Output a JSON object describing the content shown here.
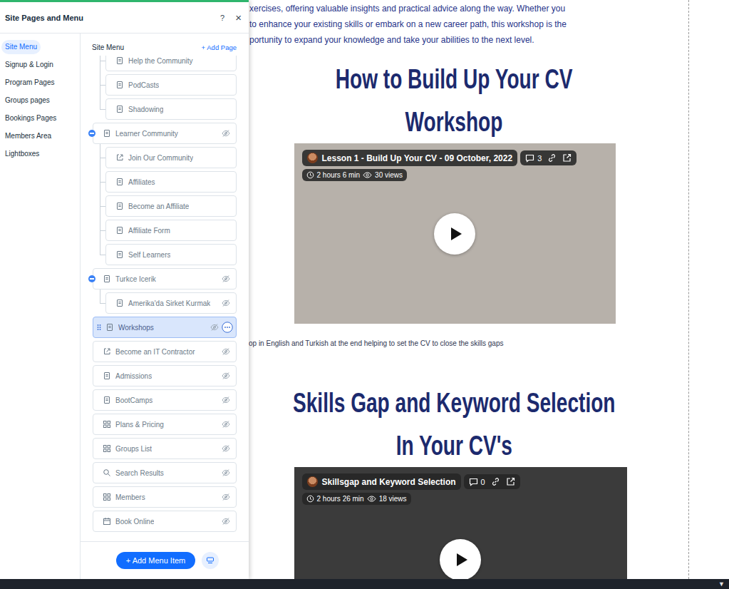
{
  "panel": {
    "title": "Site Pages and Menu",
    "help": "?",
    "close": "×"
  },
  "sections": [
    {
      "label": "Site Menu",
      "selected": true
    },
    {
      "label": "Signup & Login",
      "selected": false
    },
    {
      "label": "Program Pages",
      "selected": false
    },
    {
      "label": "Groups pages",
      "selected": false
    },
    {
      "label": "Bookings Pages",
      "selected": false
    },
    {
      "label": "Members Area",
      "selected": false
    },
    {
      "label": "Lightboxes",
      "selected": false
    }
  ],
  "menu": {
    "title": "Site Menu",
    "add_page": "+ Add Page",
    "items": [
      {
        "label": "Help the Community",
        "kind": "page",
        "depth": 1,
        "expanded": false,
        "hidden": false,
        "selected": false
      },
      {
        "label": "PodCasts",
        "kind": "page",
        "depth": 1,
        "expanded": false,
        "hidden": false,
        "selected": false
      },
      {
        "label": "Shadowing",
        "kind": "page",
        "depth": 1,
        "expanded": false,
        "hidden": false,
        "selected": false
      },
      {
        "label": "Learner Community",
        "kind": "page",
        "depth": 0,
        "expanded": true,
        "hidden": true,
        "selected": false
      },
      {
        "label": "Join Our Community",
        "kind": "link",
        "depth": 1,
        "expanded": false,
        "hidden": false,
        "selected": false
      },
      {
        "label": "Affiliates",
        "kind": "page",
        "depth": 1,
        "expanded": false,
        "hidden": false,
        "selected": false
      },
      {
        "label": "Become an Affiliate",
        "kind": "page",
        "depth": 1,
        "expanded": false,
        "hidden": false,
        "selected": false
      },
      {
        "label": "Affiliate Form",
        "kind": "page",
        "depth": 1,
        "expanded": false,
        "hidden": false,
        "selected": false
      },
      {
        "label": "Self Learners",
        "kind": "page",
        "depth": 1,
        "expanded": false,
        "hidden": false,
        "selected": false
      },
      {
        "label": "Turkce Icerik",
        "kind": "page",
        "depth": 0,
        "expanded": true,
        "hidden": true,
        "selected": false
      },
      {
        "label": "Amerika'da Sirket Kurmak",
        "kind": "page",
        "depth": 1,
        "expanded": false,
        "hidden": true,
        "selected": false
      },
      {
        "label": "Workshops",
        "kind": "page",
        "depth": 0,
        "expanded": false,
        "hidden": true,
        "selected": true
      },
      {
        "label": "Become an IT Contractor",
        "kind": "link",
        "depth": 0,
        "expanded": false,
        "hidden": true,
        "selected": false
      },
      {
        "label": "Admissions",
        "kind": "page",
        "depth": 0,
        "expanded": false,
        "hidden": true,
        "selected": false
      },
      {
        "label": "BootCamps",
        "kind": "page",
        "depth": 0,
        "expanded": false,
        "hidden": true,
        "selected": false
      },
      {
        "label": "Plans & Pricing",
        "kind": "app",
        "depth": 0,
        "expanded": false,
        "hidden": true,
        "selected": false
      },
      {
        "label": "Groups List",
        "kind": "app",
        "depth": 0,
        "expanded": false,
        "hidden": true,
        "selected": false
      },
      {
        "label": "Search Results",
        "kind": "search",
        "depth": 0,
        "expanded": false,
        "hidden": true,
        "selected": false
      },
      {
        "label": "Members",
        "kind": "app",
        "depth": 0,
        "expanded": false,
        "hidden": true,
        "selected": false
      },
      {
        "label": "Book Online",
        "kind": "booking",
        "depth": 0,
        "expanded": false,
        "hidden": true,
        "selected": false
      }
    ]
  },
  "add_menu_item": "+ Add Menu Item",
  "page": {
    "intro": [
      "xercises, offering valuable insights and practical advice along the way. Whether you",
      "to enhance your existing skills or embark on a new career path, this workshop is the",
      "portunity to expand your knowledge and take your abilities to the next level."
    ],
    "sections": [
      {
        "heading": [
          "How to Build Up Your CV",
          "Workshop"
        ],
        "video": {
          "title": "Lesson 1 - Build Up Your CV - 09 October, 2022",
          "comments": "3",
          "duration": "2 hours 6 min",
          "views": "30 views"
        },
        "caption": "op in English and Turkish at the end helping to set the CV to close the skills gaps"
      },
      {
        "heading": [
          "Skills Gap and Keyword Selection",
          "In Your CV's"
        ],
        "video": {
          "title": "Skillsgap and Keyword Selection",
          "comments": "0",
          "duration": "2 hours 26 min",
          "views": "18 views"
        },
        "caption": ""
      }
    ]
  },
  "scroll_toggle": "▼"
}
